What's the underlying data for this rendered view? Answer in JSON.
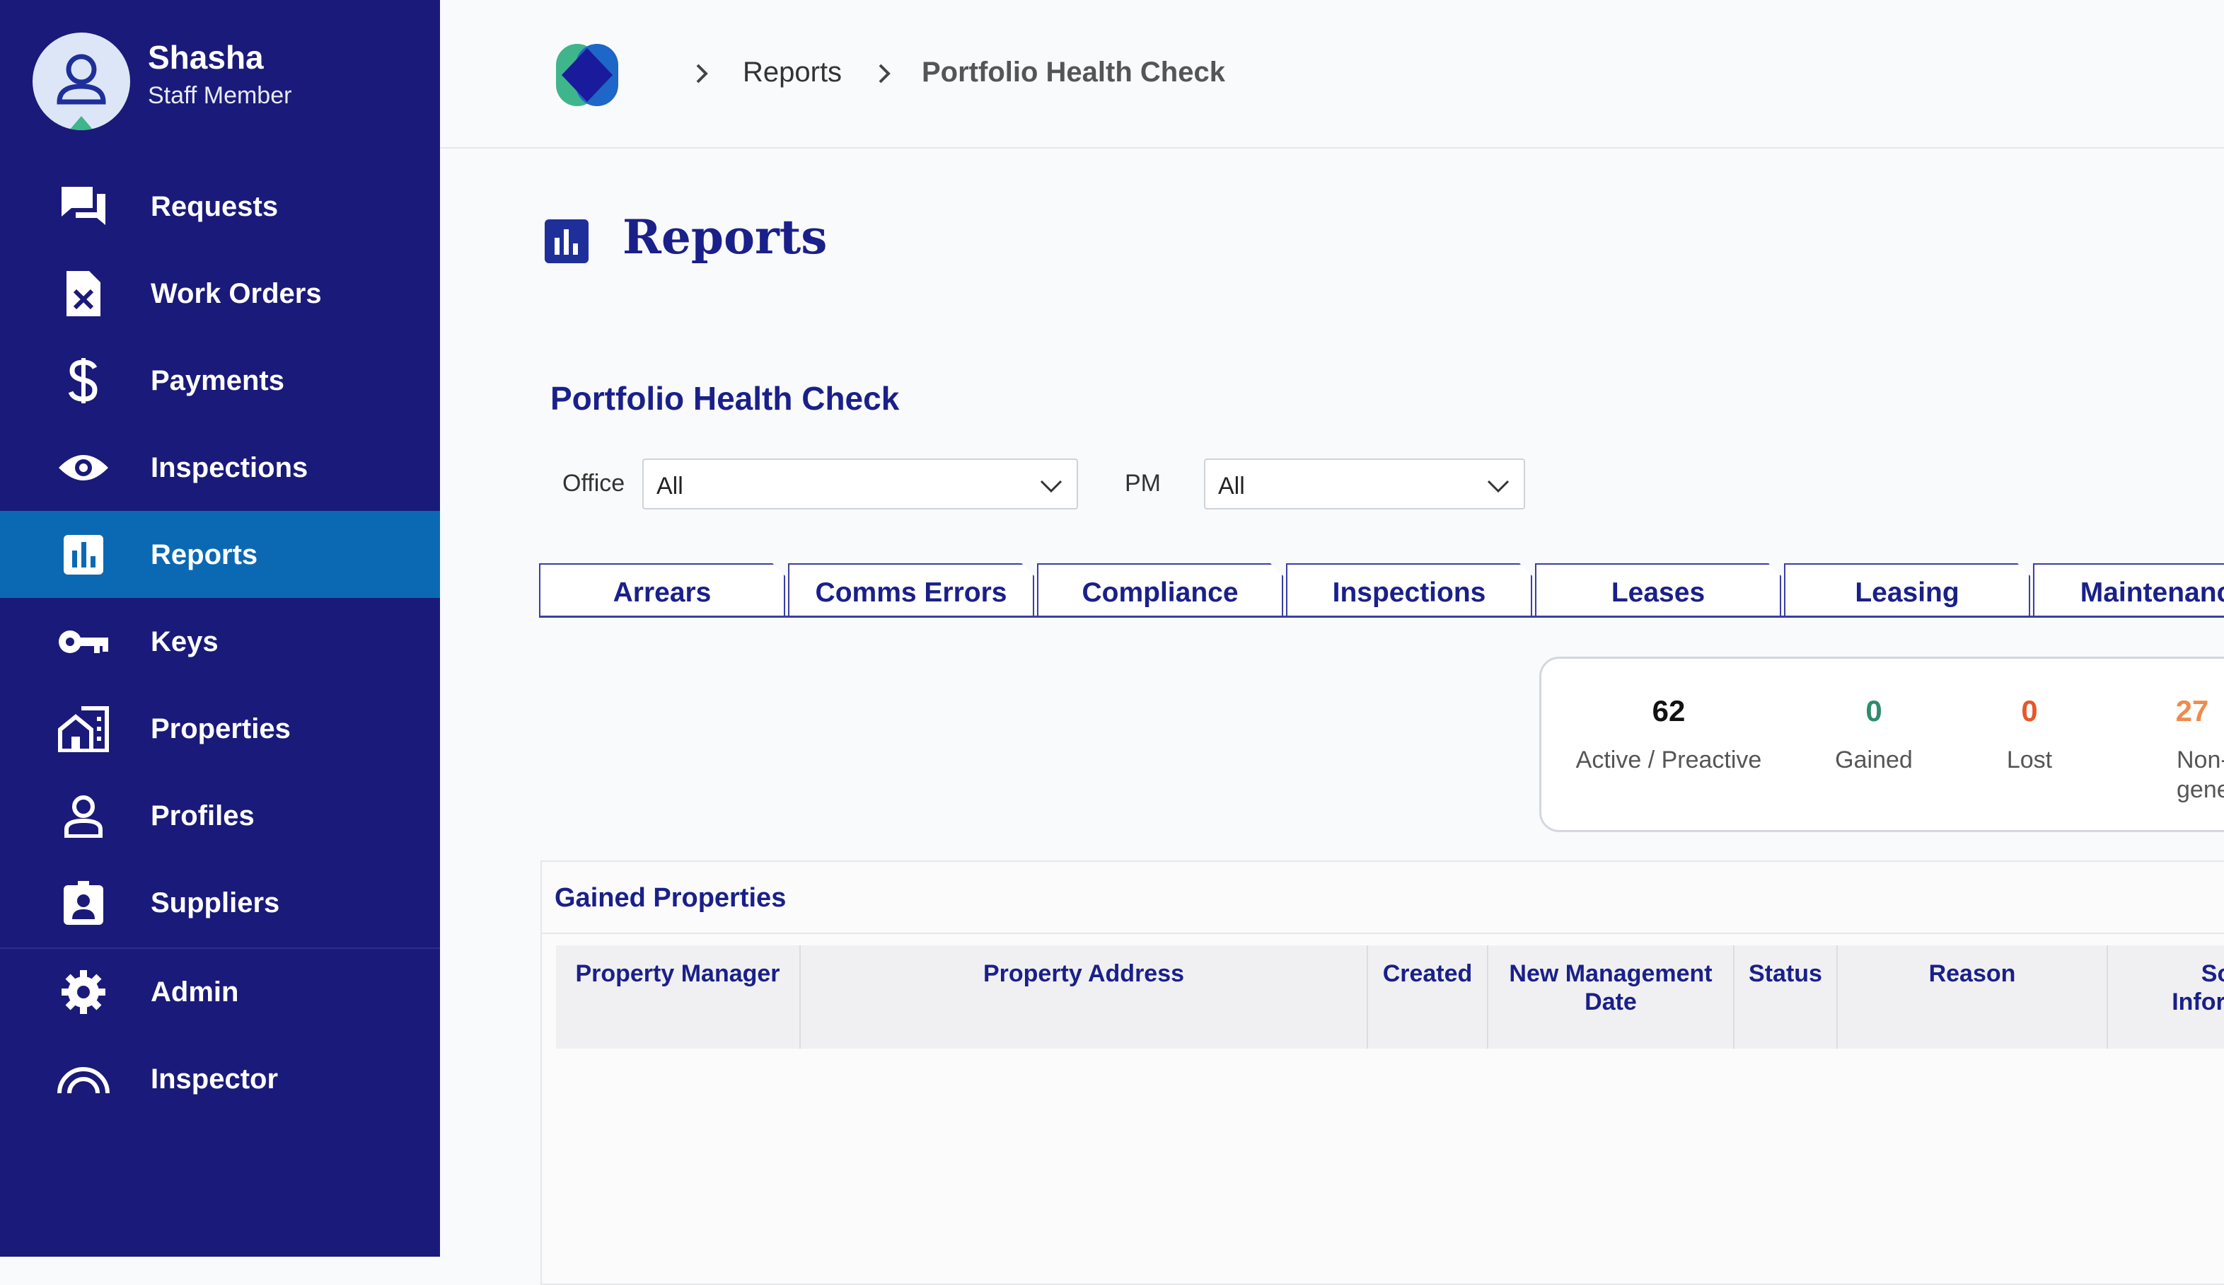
{
  "user": {
    "name": "Shasha",
    "role": "Staff Member"
  },
  "nav": [
    {
      "label": "Requests",
      "icon": "chat-icon",
      "active": false
    },
    {
      "label": "Work Orders",
      "icon": "work-order-icon",
      "active": false
    },
    {
      "label": "Payments",
      "icon": "dollar-icon",
      "active": false
    },
    {
      "label": "Inspections",
      "icon": "eye-icon",
      "active": false
    },
    {
      "label": "Reports",
      "icon": "bar-chart-icon",
      "active": true
    },
    {
      "label": "Keys",
      "icon": "key-icon",
      "active": false
    },
    {
      "label": "Properties",
      "icon": "building-icon",
      "active": false
    },
    {
      "label": "Profiles",
      "icon": "person-icon",
      "active": false
    },
    {
      "label": "Suppliers",
      "icon": "badge-icon",
      "active": false
    },
    {
      "label": "Admin",
      "icon": "gear-icon",
      "active": false
    },
    {
      "label": "Inspector",
      "icon": "gauge-icon",
      "active": false
    }
  ],
  "breadcrumb": {
    "level1": "Reports",
    "level2": "Portfolio Health Check"
  },
  "page": {
    "title": "Reports"
  },
  "report": {
    "title": "Portfolio Health Check",
    "filters": {
      "office": {
        "label": "Office",
        "value": "All"
      },
      "pm": {
        "label": "PM",
        "value": "All"
      }
    },
    "tabs": [
      "Arrears",
      "Comms Errors",
      "Compliance",
      "Inspections",
      "Leases",
      "Leasing",
      "Maintenanc"
    ],
    "stats": [
      {
        "value": "62",
        "label": "Active / Preactive",
        "color": "#111111"
      },
      {
        "value": "0",
        "label": "Gained",
        "color": "#2e8b6e"
      },
      {
        "value": "0",
        "label": "Lost",
        "color": "#e8562a"
      },
      {
        "value": "27",
        "label": "Non-Inco generat",
        "color": "#f08a4b"
      }
    ],
    "gained": {
      "title": "Gained Properties",
      "columns": [
        "Property Manager",
        "Property Address",
        "Created",
        "New Management Date",
        "Status",
        "Reason",
        "Sou Inform"
      ]
    }
  },
  "colors": {
    "sidebar": "#1a1a7a",
    "active": "#0b69b3",
    "accent": "#1a2089"
  }
}
